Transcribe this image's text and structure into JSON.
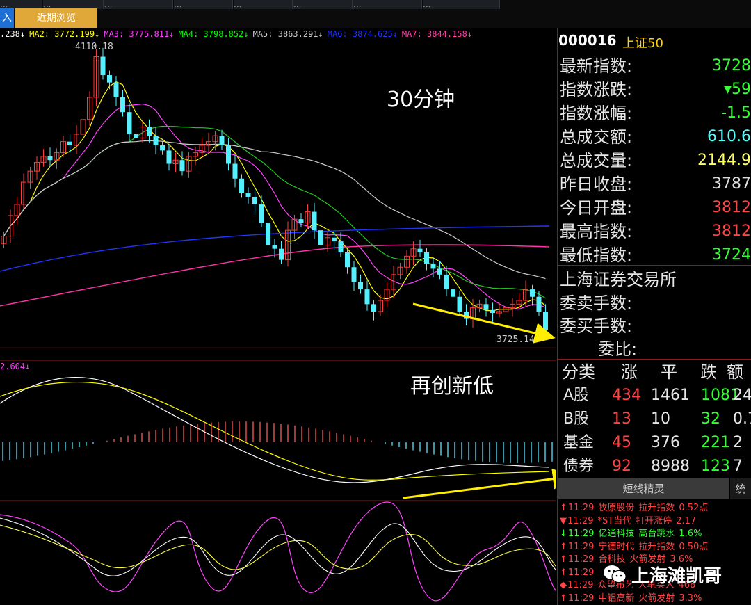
{
  "tabs": {
    "top_labels": [
      "...",
      "...",
      "...",
      "...",
      "...",
      "...",
      "...",
      "...",
      "..."
    ],
    "left_label": "入",
    "recent_label": "近期浏览"
  },
  "ma_bar": [
    {
      "text": ".238↓",
      "color": "#ffffff"
    },
    {
      "text": "MA2: 3772.199↓",
      "color": "#ffff00"
    },
    {
      "text": "MA3: 3775.811↓",
      "color": "#ff44ff"
    },
    {
      "text": "MA4: 3798.852↓",
      "color": "#00ff00"
    },
    {
      "text": "MA5: 3863.291↓",
      "color": "#cccccc"
    },
    {
      "text": "MA6: 3874.625↓",
      "color": "#2233ff"
    },
    {
      "text": "MA7: 3844.158↓",
      "color": "#ff44aa"
    }
  ],
  "chart": {
    "high_label": "4110.18",
    "low_label": "3725.14",
    "period_label": "30分钟",
    "new_low_label": "再创新低",
    "macd_label": "2.604↓"
  },
  "chart_data": {
    "type": "candlestick",
    "period": "30分钟",
    "high_annotation": 4110.18,
    "low_annotation": 3725.14
  },
  "quote": {
    "code": "000016",
    "name": "上证50",
    "rows": [
      {
        "label": "最新指数:",
        "value": "3728",
        "color": "#33ff33"
      },
      {
        "label": "指数涨跌:",
        "value": "▾59",
        "color": "#33ff33"
      },
      {
        "label": "指数涨幅:",
        "value": "-1.5",
        "color": "#33ff33"
      },
      {
        "label": "总成交额:",
        "value": "610.6",
        "color": "#55ffff"
      },
      {
        "label": "总成交量:",
        "value": "2144.9",
        "color": "#ffff66"
      },
      {
        "label": "昨日收盘:",
        "value": "3787",
        "color": "#dddddd"
      },
      {
        "label": "今日开盘:",
        "value": "3812",
        "color": "#ff4444"
      },
      {
        "label": "最高指数:",
        "value": "3812",
        "color": "#ff4444"
      },
      {
        "label": "最低指数:",
        "value": "3724",
        "color": "#33ff33"
      }
    ],
    "exchange": "上海证券交易所",
    "order_rows": [
      "委卖手数:",
      "委买手数:",
      "委比:"
    ]
  },
  "stats": {
    "headers": [
      "分类",
      "涨",
      "平",
      "跌",
      "额"
    ],
    "rows": [
      {
        "cat": "A股",
        "up": "434",
        "flat": "1461",
        "down": "1081",
        "amt": "24"
      },
      {
        "cat": "B股",
        "up": "13",
        "flat": "10",
        "down": "32",
        "amt": "0.7"
      },
      {
        "cat": "基金",
        "up": "45",
        "flat": "376",
        "down": "221",
        "amt": "2"
      },
      {
        "cat": "债券",
        "up": "92",
        "flat": "8988",
        "down": "123",
        "amt": "7"
      }
    ]
  },
  "short_line": {
    "tab_label": "短线精灵",
    "tab2_label": "统",
    "items": [
      {
        "arrow": "↑",
        "time": "11:29",
        "name": "牧原股份",
        "event": "拉升指数",
        "val": "0.52点",
        "color": "#ff4444"
      },
      {
        "arrow": "▼",
        "time": "11:29",
        "name": "*ST当代",
        "event": "打开涨停",
        "val": "2.17",
        "color": "#ff4444"
      },
      {
        "arrow": "↓",
        "time": "11:29",
        "name": "亿通科技",
        "event": "高台跳水",
        "val": "1.6%",
        "color": "#33ff33"
      },
      {
        "arrow": "↑",
        "time": "11:29",
        "name": "宁德时代",
        "event": "拉升指数",
        "val": "0.50点",
        "color": "#ff4444"
      },
      {
        "arrow": "↑",
        "time": "11:29",
        "name": "合科技",
        "event": "火箭发射",
        "val": "3.6%",
        "color": "#ff4444"
      },
      {
        "arrow": "↑",
        "time": "11:29",
        "name": "",
        "event": "",
        "val": "%",
        "color": "#ff4444"
      },
      {
        "arrow": "◆",
        "time": "11:29",
        "name": "众望布艺",
        "event": "大笔买入",
        "val": "468",
        "color": "#ff4444"
      },
      {
        "arrow": "↑",
        "time": "11:29",
        "name": "中铝高新",
        "event": "火箭发射",
        "val": "3.3%",
        "color": "#ff4444"
      }
    ]
  },
  "watermark": "上海滩凯哥"
}
